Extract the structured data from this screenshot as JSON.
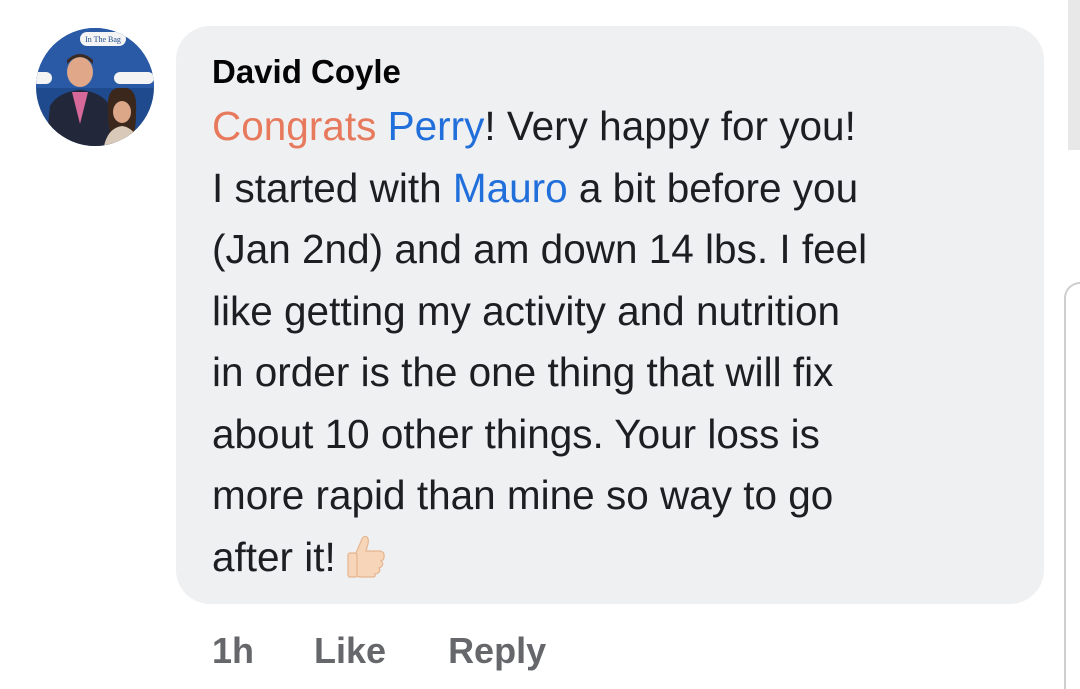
{
  "comment": {
    "author": "David Coyle",
    "lines": {
      "l1_congrats": "Congrats",
      "l1_mention": "Perry",
      "l1_rest": "! Very happy for you!",
      "l2_start": "I started with ",
      "l2_mention": "Mauro",
      "l2_rest": " a bit before you",
      "l3": "(Jan 2nd) and am down 14 lbs. I feel",
      "l4": "like getting my activity and nutrition",
      "l5": "in order is the one thing that will fix",
      "l6": "about 10 other things. Your loss is",
      "l7": "more rapid than mine so way to go",
      "l8": "after it!"
    },
    "emoji": "thumbs-up-icon",
    "avatar_banner_text": "In The Bag"
  },
  "actions": {
    "time": "1h",
    "like": "Like",
    "reply": "Reply"
  },
  "colors": {
    "bubble": "#eff0f2",
    "congrats": "#e7795d",
    "mention": "#216fdb",
    "action_text": "#65676b"
  }
}
